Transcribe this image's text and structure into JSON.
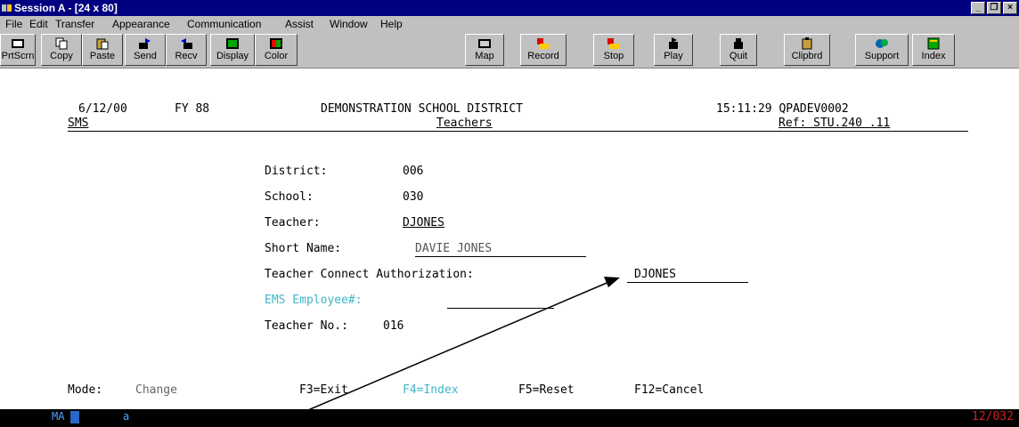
{
  "window": {
    "title": "Session A - [24 x 80]",
    "controls": [
      "_",
      "❐",
      "×"
    ]
  },
  "menu": [
    "File",
    "Edit",
    "Transfer",
    "Appearance",
    "Communication",
    "Assist",
    "Window",
    "Help"
  ],
  "toolbar": [
    {
      "label": "PrtScrn",
      "icon": "print-screen-icon"
    },
    {
      "label": "Copy",
      "icon": "copy-icon"
    },
    {
      "label": "Paste",
      "icon": "paste-icon"
    },
    {
      "label": "Send",
      "icon": "send-icon"
    },
    {
      "label": "Recv",
      "icon": "receive-icon"
    },
    {
      "label": "Display",
      "icon": "display-icon"
    },
    {
      "label": "Color",
      "icon": "color-icon"
    },
    {
      "label": "Map",
      "icon": "map-icon"
    },
    {
      "label": "Record",
      "icon": "record-icon"
    },
    {
      "label": "Stop",
      "icon": "stop-icon"
    },
    {
      "label": "Play",
      "icon": "play-icon"
    },
    {
      "label": "Quit",
      "icon": "quit-icon"
    },
    {
      "label": "Clipbrd",
      "icon": "clipboard-icon"
    },
    {
      "label": "Support",
      "icon": "support-icon"
    },
    {
      "label": "Index",
      "icon": "index-icon"
    }
  ],
  "header": {
    "date": "6/12/00",
    "fy": "FY 88",
    "district_title": "DEMONSTRATION SCHOOL DISTRICT",
    "time_job": "15:11:29 QPADEV0002",
    "system": "SMS",
    "subtitle": "Teachers",
    "ref": "Ref: STU.240 .11"
  },
  "form": {
    "district_label": "District:",
    "district_value": "006",
    "school_label": "School:",
    "school_value": "030",
    "teacher_label": "Teacher:",
    "teacher_value": "DJONES",
    "short_name_label": "Short Name:",
    "short_name_value": "DAVIE JONES",
    "connect_label": "Teacher Connect Authorization:",
    "connect_value": "DJONES",
    "ems_label": "EMS Employee#:",
    "ems_value": "",
    "teacher_no_label": "Teacher No.:",
    "teacher_no_value": "016"
  },
  "footer": {
    "mode_label": "Mode:",
    "mode_value": "Change",
    "f3": "F3=Exit",
    "f4": "F4=Index",
    "f5": "F5=Reset",
    "f12": "F12=Cancel"
  },
  "status": {
    "indicator": "MA",
    "input": "a",
    "cursor_pos": "12/032"
  }
}
